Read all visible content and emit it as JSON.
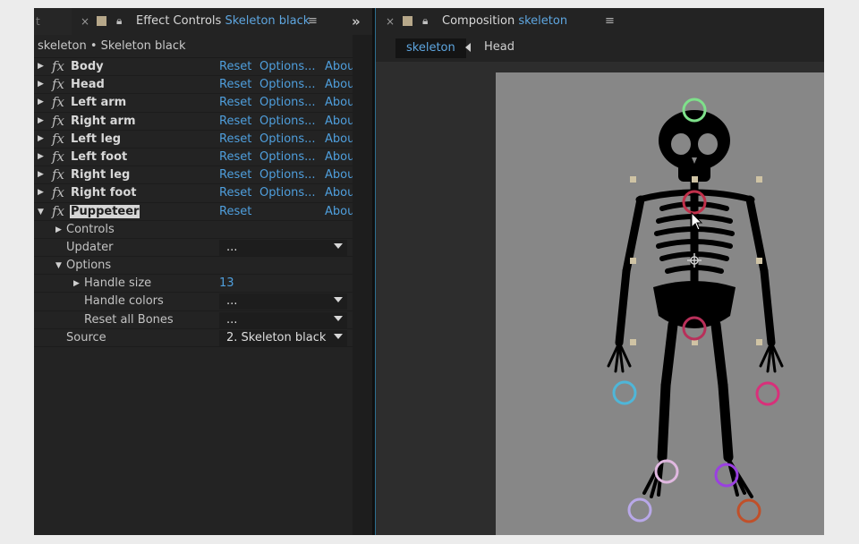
{
  "left_panel": {
    "stub_tab_label": "t",
    "tab_close": "×",
    "tab_title": "Effect Controls",
    "tab_layer": "Skeleton black",
    "tab_menu": "≡",
    "overflow": "»",
    "path": "skeleton • Skeleton black",
    "effects": [
      {
        "name": "Body",
        "reset": "Reset",
        "options": "Options...",
        "about": "Abou"
      },
      {
        "name": "Head",
        "reset": "Reset",
        "options": "Options...",
        "about": "Abou"
      },
      {
        "name": "Left arm",
        "reset": "Reset",
        "options": "Options...",
        "about": "Abou"
      },
      {
        "name": "Right arm",
        "reset": "Reset",
        "options": "Options...",
        "about": "Abou"
      },
      {
        "name": "Left leg",
        "reset": "Reset",
        "options": "Options...",
        "about": "Abou"
      },
      {
        "name": "Left foot",
        "reset": "Reset",
        "options": "Options...",
        "about": "Abou"
      },
      {
        "name": "Right leg",
        "reset": "Reset",
        "options": "Options...",
        "about": "Abou"
      },
      {
        "name": "Right foot",
        "reset": "Reset",
        "options": "Options...",
        "about": "Abou"
      }
    ],
    "puppeteer": {
      "name": "Puppeteer",
      "reset": "Reset",
      "about": "Abou"
    },
    "fx_glyph": "fx",
    "props": {
      "controls": "Controls",
      "updater": "Updater",
      "updater_value": "...",
      "options": "Options",
      "handle_size": "Handle size",
      "handle_size_value": "13",
      "handle_colors": "Handle colors",
      "handle_colors_value": "...",
      "reset_bones": "Reset all Bones",
      "reset_bones_value": "...",
      "source": "Source",
      "source_value": "2. Skeleton black"
    }
  },
  "right_panel": {
    "tab_close": "×",
    "tab_title": "Composition",
    "tab_comp": "skeleton",
    "tab_menu": "≡",
    "breadcrumb_active": "skeleton",
    "breadcrumb_next": "Head"
  },
  "handle_colors": [
    "#7ee08a",
    "#c0304a",
    "#b8305a",
    "#4fb6d8",
    "#d8307a",
    "#e0b8e0",
    "#9a40e0",
    "#b8a8e8",
    "#c0502a"
  ],
  "accent": "#5ea6e0"
}
